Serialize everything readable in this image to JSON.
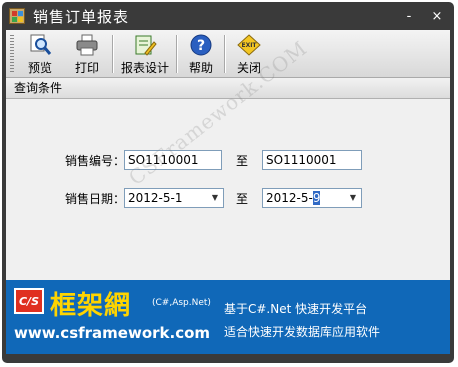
{
  "window": {
    "title": "销售订单报表",
    "minimize": "-",
    "close": "×"
  },
  "toolbar": {
    "items": [
      {
        "label": "预览",
        "icon": "preview-magnifier-icon"
      },
      {
        "label": "打印",
        "icon": "printer-icon"
      },
      {
        "label": "报表设计",
        "icon": "report-design-icon"
      },
      {
        "label": "帮助",
        "icon": "help-icon"
      },
      {
        "label": "关闭",
        "icon": "exit-icon"
      }
    ]
  },
  "query": {
    "section_title": "查询条件",
    "order_no_label": "销售编号：",
    "order_no_from": "SO1110001",
    "to_label": "至",
    "order_no_to": "SO1110001",
    "date_label": "销售日期：",
    "date_from": "2012-5-1",
    "date_to_prefix": "2012-5-",
    "date_to_selected": "9"
  },
  "banner": {
    "logo_badge": "C/S",
    "brand": "框架網",
    "tech": "(C#,Asp.Net)",
    "url": "www.csframework.com",
    "slogan_1": "基于C#.Net 快速开发平台",
    "slogan_2": "适合快速开发数据库应用软件"
  },
  "watermark": "CSFramework.COM",
  "colors": {
    "window_frame": "#3a3a3a",
    "banner_bg": "#1068b8",
    "selection": "#316ac5",
    "brand_yellow": "#ffd400"
  }
}
